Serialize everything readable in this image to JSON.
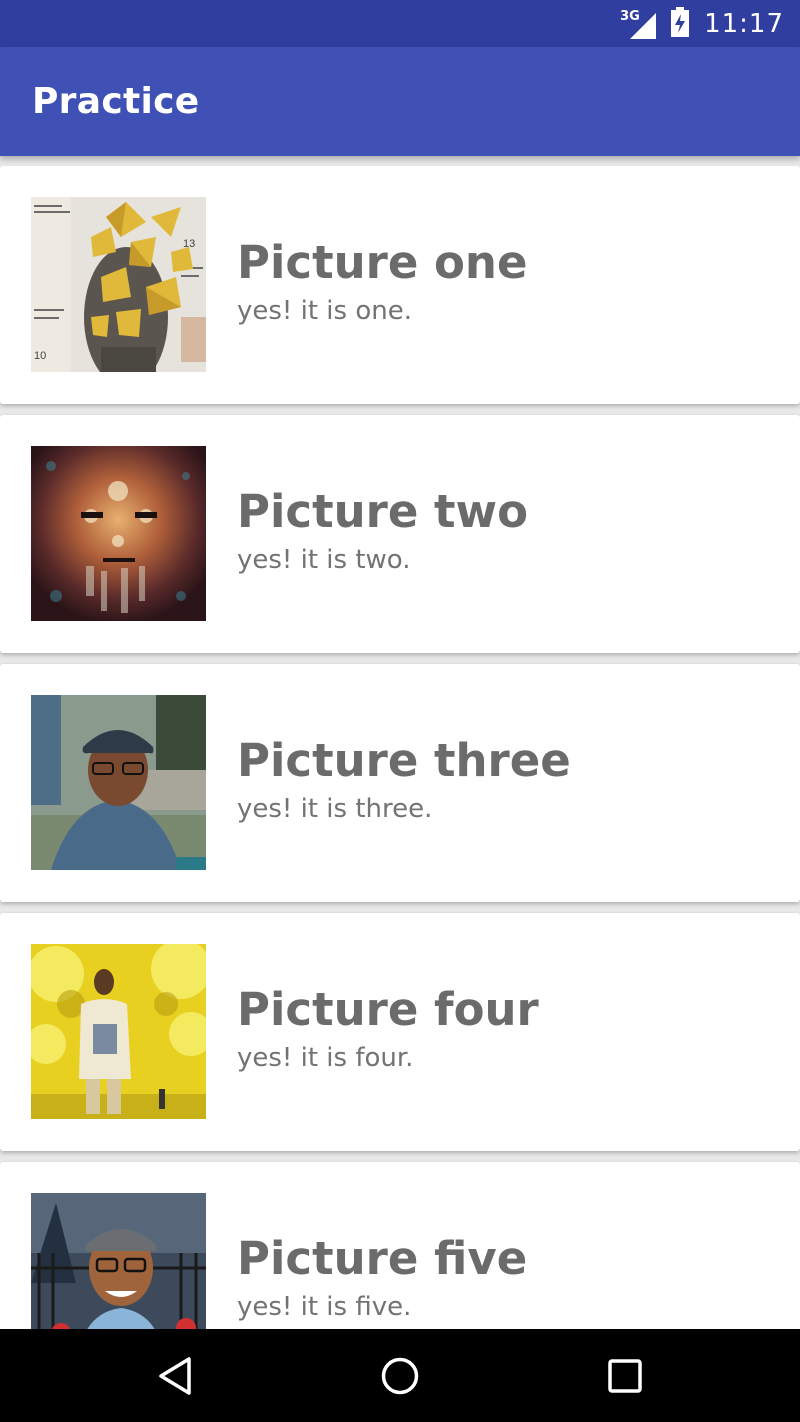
{
  "status_bar": {
    "network_label": "3G",
    "time": "11:17"
  },
  "app_bar": {
    "title": "Practice"
  },
  "items": [
    {
      "title": "Picture one",
      "subtitle": "yes! it is one.",
      "image": "origami-face-image"
    },
    {
      "title": "Picture two",
      "subtitle": "yes! it is two.",
      "image": "mosaic-portrait-image"
    },
    {
      "title": "Picture three",
      "subtitle": "yes! it is three.",
      "image": "man-with-cap-image"
    },
    {
      "title": "Picture four",
      "subtitle": "yes! it is four.",
      "image": "man-yellow-trees-image"
    },
    {
      "title": "Picture five",
      "subtitle": "yes! it is five.",
      "image": "cartoon-avatar-image"
    }
  ],
  "nav_bar": {
    "back_icon": "back-triangle-icon",
    "home_icon": "home-circle-icon",
    "recents_icon": "recents-square-icon"
  },
  "colors": {
    "status_bar": "#303f9f",
    "app_bar": "#3f51b5",
    "title_text": "#6b6b6b",
    "subtitle_text": "#737373"
  }
}
